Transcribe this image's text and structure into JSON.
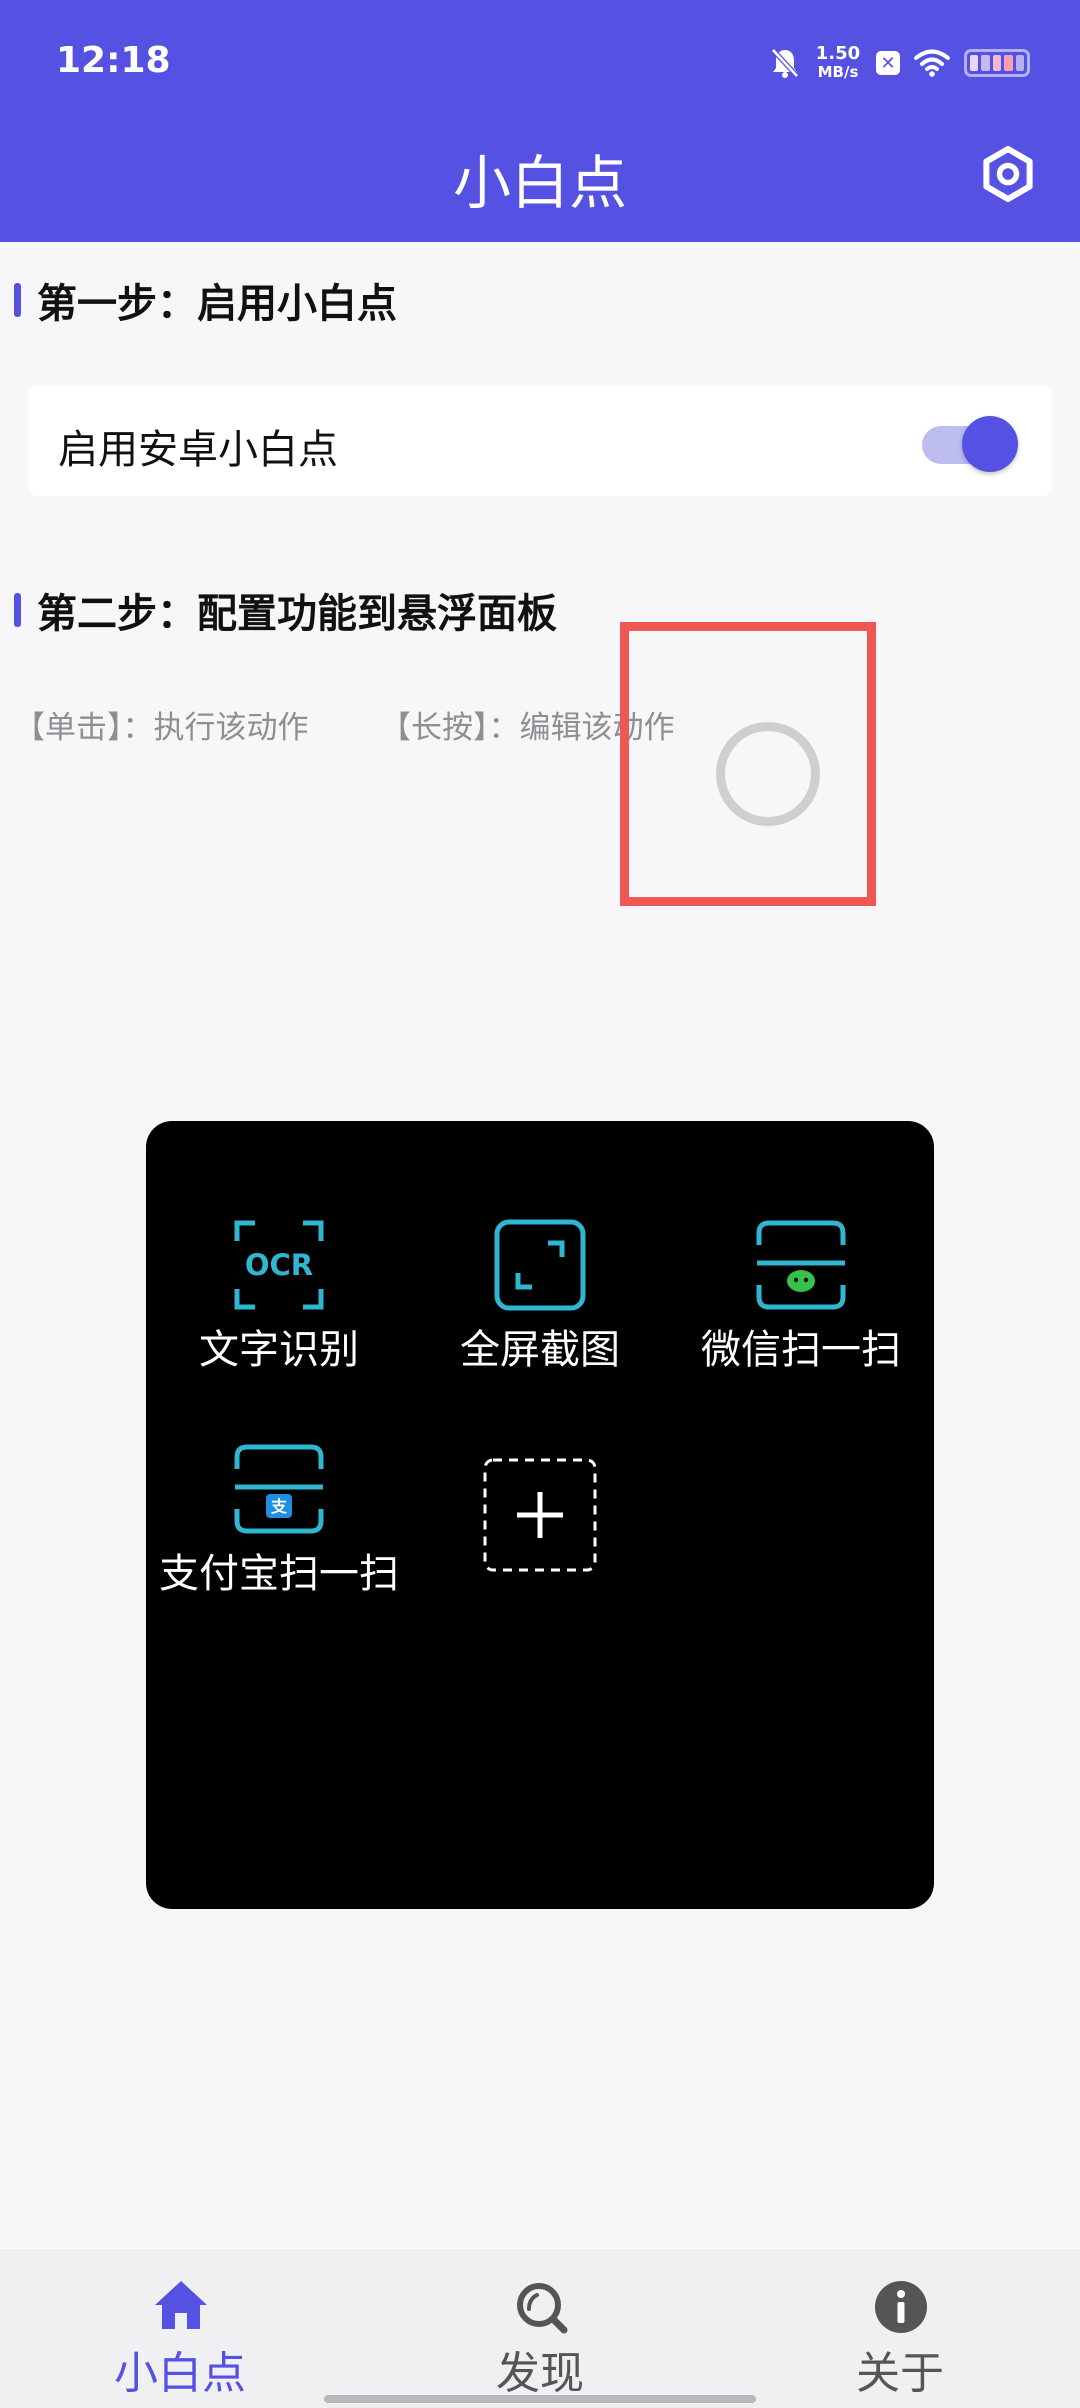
{
  "status_bar": {
    "time": "12:18",
    "net_speed_value": "1.50",
    "net_speed_unit": "MB/s",
    "icons": [
      "bell-mute-icon",
      "x-box-icon",
      "wifi-icon",
      "battery-icon"
    ]
  },
  "header": {
    "title": "小白点",
    "settings_icon": "gear-icon"
  },
  "step1": {
    "title": "第一步：启用小白点",
    "toggle_label": "启用安卓小白点",
    "toggle_on": true
  },
  "step2": {
    "title": "第二步：配置功能到悬浮面板",
    "hint_click": "【单击】：执行该动作",
    "hint_longpress": "【长按】：编辑该动作"
  },
  "panel": {
    "items": [
      {
        "label": "文字识别",
        "icon": "ocr-icon"
      },
      {
        "label": "全屏截图",
        "icon": "fullscreen-screenshot-icon"
      },
      {
        "label": "微信扫一扫",
        "icon": "wechat-scan-icon"
      },
      {
        "label": "支付宝扫一扫",
        "icon": "alipay-scan-icon"
      }
    ],
    "add_icon": "add-icon"
  },
  "bottom_nav": {
    "items": [
      {
        "label": "小白点",
        "icon": "home-icon",
        "active": true
      },
      {
        "label": "发现",
        "icon": "discover-search-icon",
        "active": false
      },
      {
        "label": "关于",
        "icon": "info-icon",
        "active": false
      }
    ]
  },
  "colors": {
    "primary": "#5552e3",
    "highlight": "#ee5752",
    "panel_bg": "#000000",
    "icon_teal": "#2fb7d2"
  }
}
